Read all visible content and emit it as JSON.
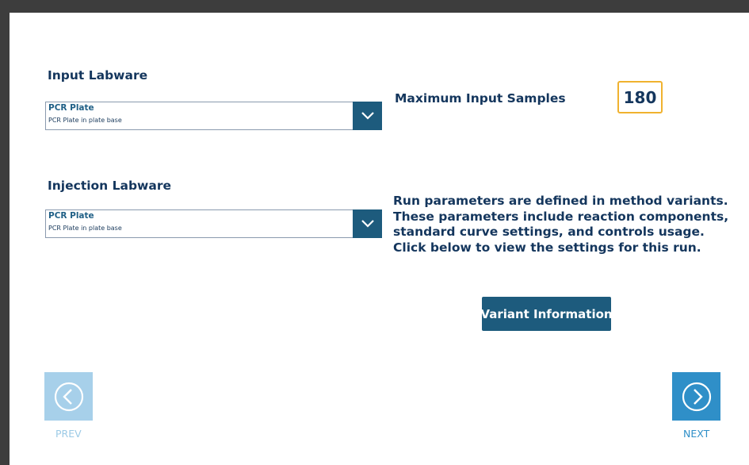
{
  "input_labware": {
    "label": "Input Labware",
    "selected_title": "PCR Plate",
    "selected_subtitle": "PCR Plate in plate base"
  },
  "injection_labware": {
    "label": "Injection Labware",
    "selected_title": "PCR Plate",
    "selected_subtitle": "PCR Plate in plate base"
  },
  "max_input": {
    "label": "Maximum Input Samples",
    "value": "180"
  },
  "run_info": {
    "lines": [
      "Run parameters are defined in method variants.",
      "These parameters include reaction components,",
      "standard curve settings, and controls usage.",
      "Click below to view the settings for this run."
    ]
  },
  "variant_button": {
    "label": "Variant Information"
  },
  "nav": {
    "prev_label": "PREV",
    "next_label": "NEXT"
  },
  "icons": {
    "dropdown": "chevron-down-icon",
    "prev": "chevron-left-circle-icon",
    "next": "chevron-right-circle-icon"
  },
  "colors": {
    "heading": "#14365d",
    "accent_dark": "#1d5b7d",
    "highlight_border": "#f0b22f",
    "next_button": "#2f8fc8",
    "prev_button_disabled": "#a7d0ea"
  }
}
